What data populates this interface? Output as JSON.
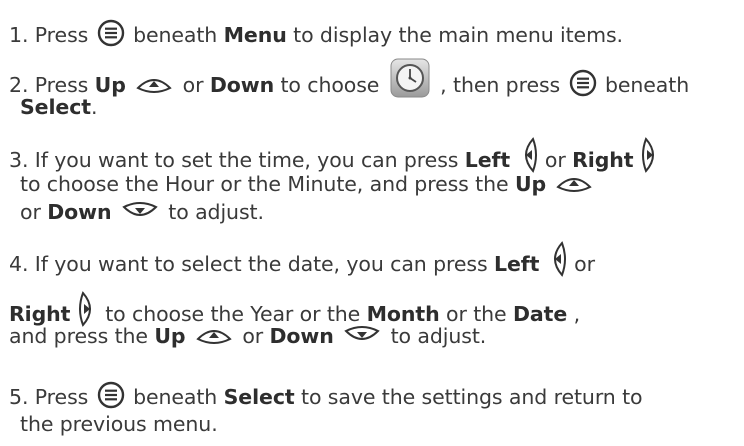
{
  "steps": [
    {
      "num": "1.",
      "parts": [
        "Press",
        "beneath",
        "Menu",
        "to display the main menu items."
      ],
      "icons": [
        "menu-button-icon"
      ]
    },
    {
      "num": "2.",
      "parts": [
        "Press",
        "Up",
        "or",
        "Down",
        "to choose",
        ", then press",
        "beneath",
        "Select",
        "."
      ],
      "icons": [
        "up-arrow-icon",
        "down-arrow-icon",
        "clock-app-icon",
        "menu-button-icon"
      ]
    },
    {
      "num": "3.",
      "parts": [
        "If you want to set the time, you can press",
        "Left",
        "or",
        "Right",
        "to choose the Hour or the Minute, and press the",
        "Up",
        "or",
        "Down",
        "to adjust."
      ],
      "icons": [
        "left-arrow-icon",
        "right-arrow-icon",
        "up-arrow-icon",
        "down-arrow-icon"
      ]
    },
    {
      "num": "4.",
      "parts": [
        "If you want to select the date,  you can press",
        "Left",
        "or",
        "Right",
        "to choose the Year or the",
        "Month",
        "or the",
        "Date",
        ",",
        "and press the",
        "Up",
        "or",
        "Down",
        "to adjust."
      ],
      "icons": [
        "left-arrow-icon",
        "right-arrow-icon",
        "up-arrow-icon",
        "down-arrow-icon"
      ]
    },
    {
      "num": "5.",
      "parts": [
        "Press",
        "beneath",
        "Select",
        "to save the settings and return to",
        "the previous menu."
      ],
      "icons": [
        "menu-button-icon"
      ]
    }
  ],
  "colors": {
    "text": "#3a3a3a",
    "bold": "#2e2e2e",
    "icon_stroke": "#333333"
  }
}
